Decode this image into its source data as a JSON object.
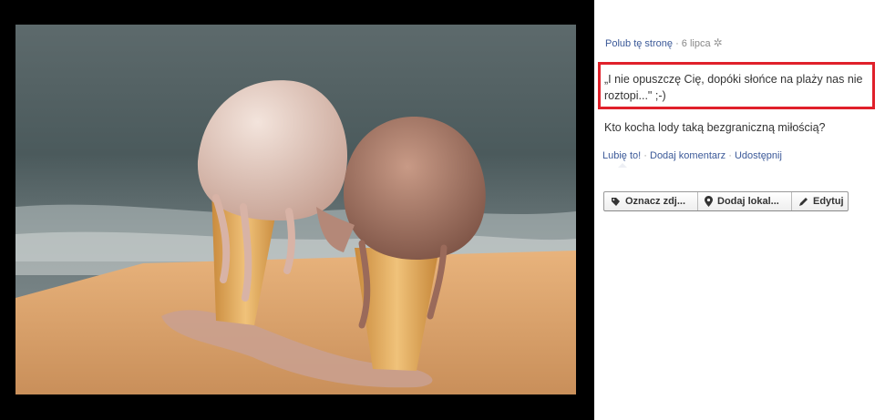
{
  "post": {
    "like_page": "Polub tę stronę",
    "date": "6 lipca",
    "quote": "„I nie opuszczę Cię, dopóki słońce na plaży nas nie roztopi...\" ;-)",
    "description": "Kto kocha lody taką bezgraniczną miłością?",
    "actions": {
      "like": "Lubię to!",
      "comment": "Dodaj komentarz",
      "share": "Udostępnij"
    },
    "separator": "·"
  },
  "toolbar": {
    "tag": "Oznacz zdj...",
    "location": "Dodaj lokal...",
    "edit": "Edytuj",
    "icons": [
      "tag-icon",
      "location-pin-icon",
      "pencil-icon"
    ]
  },
  "colors": {
    "link": "#3b5998",
    "highlight": "#e0202a",
    "viewer_bg": "#000000"
  }
}
